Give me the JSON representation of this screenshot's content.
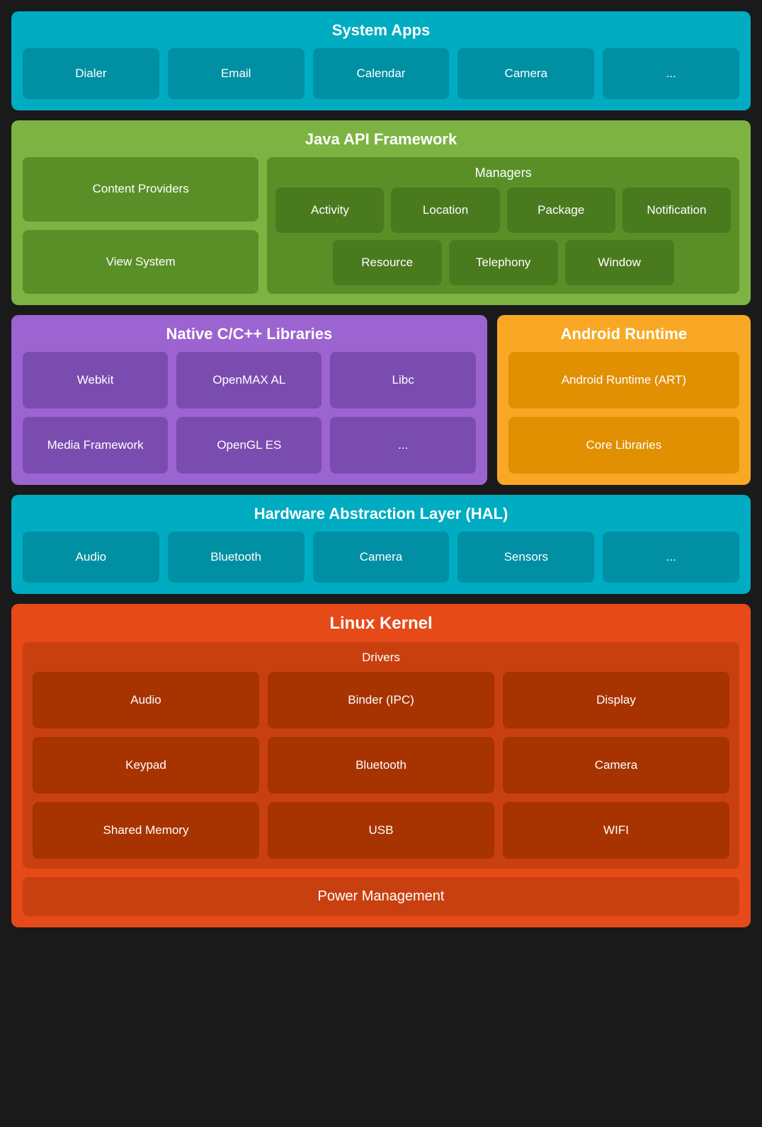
{
  "system_apps": {
    "title": "System Apps",
    "items": [
      "Dialer",
      "Email",
      "Calendar",
      "Camera",
      "..."
    ]
  },
  "java_api": {
    "title": "Java API Framework",
    "left": [
      "Content Providers",
      "View System"
    ],
    "managers_title": "Managers",
    "managers_row1": [
      "Activity",
      "Location",
      "Package",
      "Notification"
    ],
    "managers_row2": [
      "Resource",
      "Telephony",
      "Window"
    ]
  },
  "native_libs": {
    "title": "Native C/C++ Libraries",
    "items": [
      "Webkit",
      "OpenMAX AL",
      "Libc",
      "Media Framework",
      "OpenGL ES",
      "..."
    ]
  },
  "android_runtime": {
    "title": "Android Runtime",
    "items": [
      "Android Runtime (ART)",
      "Core Libraries"
    ]
  },
  "hal": {
    "title": "Hardware Abstraction Layer (HAL)",
    "items": [
      "Audio",
      "Bluetooth",
      "Camera",
      "Sensors",
      "..."
    ]
  },
  "linux_kernel": {
    "title": "Linux Kernel",
    "drivers_title": "Drivers",
    "drivers": [
      "Audio",
      "Binder (IPC)",
      "Display",
      "Keypad",
      "Bluetooth",
      "Camera",
      "Shared Memory",
      "USB",
      "WIFI"
    ],
    "power_management": "Power Management"
  }
}
